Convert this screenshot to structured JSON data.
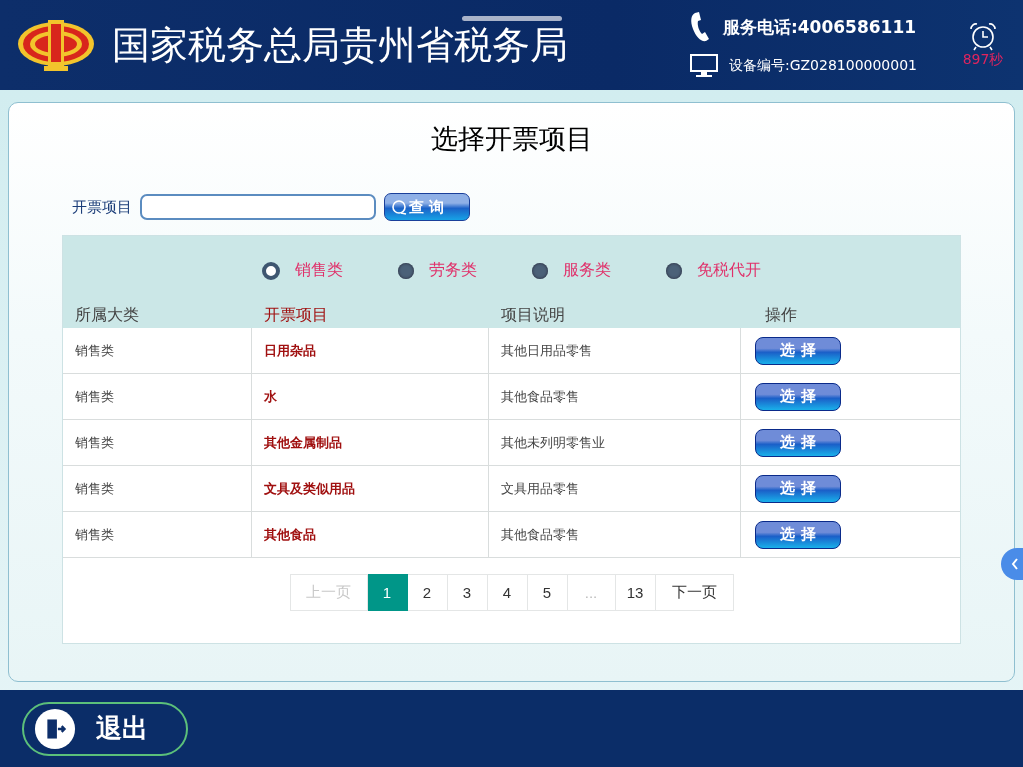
{
  "header": {
    "title": "国家税务总局贵州省税务局",
    "phone": "服务电话:4006586111",
    "device": "设备编号:GZ028100000001",
    "countdown": "897秒"
  },
  "page": {
    "title": "选择开票项目"
  },
  "search": {
    "label": "开票项目",
    "button": "查 询"
  },
  "categories": [
    {
      "label": "销售类",
      "selected": true
    },
    {
      "label": "劳务类",
      "selected": false
    },
    {
      "label": "服务类",
      "selected": false
    },
    {
      "label": "免税代开",
      "selected": false
    }
  ],
  "table": {
    "columns": [
      "所属大类",
      "开票项目",
      "项目说明",
      "操作"
    ],
    "rows": [
      {
        "category": "销售类",
        "item": "日用杂品",
        "description": "其他日用品零售",
        "action": "选 择"
      },
      {
        "category": "销售类",
        "item": "水",
        "description": "其他食品零售",
        "action": "选 择"
      },
      {
        "category": "销售类",
        "item": "其他金属制品",
        "description": "其他未列明零售业",
        "action": "选 择"
      },
      {
        "category": "销售类",
        "item": "文具及类似用品",
        "description": "文具用品零售",
        "action": "选 择"
      },
      {
        "category": "销售类",
        "item": "其他食品",
        "description": "其他食品零售",
        "action": "选 择"
      }
    ]
  },
  "pagination": [
    {
      "kind": "prev",
      "label": "上一页",
      "disabled": true
    },
    {
      "kind": "page",
      "label": "1",
      "selected": true
    },
    {
      "kind": "page",
      "label": "2",
      "selected": false
    },
    {
      "kind": "page",
      "label": "3",
      "selected": false
    },
    {
      "kind": "page",
      "label": "4",
      "selected": false
    },
    {
      "kind": "page",
      "label": "5",
      "selected": false
    },
    {
      "kind": "ellipsis",
      "label": "..."
    },
    {
      "kind": "page",
      "label": "13",
      "selected": false
    },
    {
      "kind": "next",
      "label": "下一页",
      "disabled": false
    }
  ],
  "footer": {
    "exit": "退出"
  }
}
